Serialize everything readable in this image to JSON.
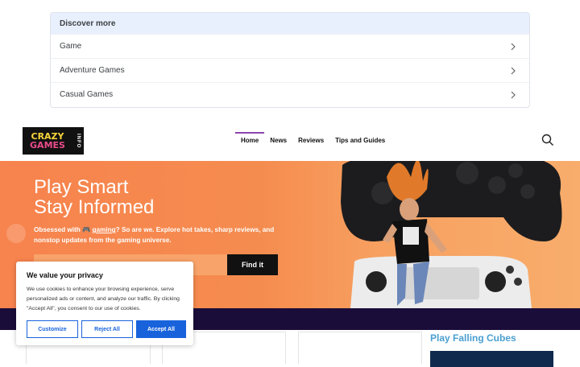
{
  "discover": {
    "title": "Discover more",
    "items": [
      {
        "label": "Game"
      },
      {
        "label": "Adventure Games"
      },
      {
        "label": "Casual Games"
      }
    ]
  },
  "header": {
    "logo": {
      "line1": "CRAZY",
      "line2": "GAMES",
      "side": "INFO"
    },
    "nav": [
      {
        "label": "Home",
        "active": true
      },
      {
        "label": "News"
      },
      {
        "label": "Reviews"
      },
      {
        "label": "Tips and Guides"
      }
    ]
  },
  "hero": {
    "title_line1": "Play Smart",
    "title_line2": "Stay Informed",
    "sub_pre": "Obsessed with ",
    "sub_link": "gaming",
    "sub_post": "? So are we. Explore hot takes, sharp reviews, and nonstop updates from the gaming universe.",
    "button": "Find it",
    "input_value": ""
  },
  "sidebar": {
    "play_title": "Play Falling Cubes"
  },
  "cookie": {
    "title": "We value your privacy",
    "text": "We use cookies to enhance your browsing experience, serve personalized ads or content, and analyze our traffic. By clicking \"Accept All\", you consent to our use of cookies.",
    "customize": "Customize",
    "reject": "Reject All",
    "accept": "Accept All"
  },
  "colors": {
    "accent": "#8e44ad",
    "hero": "#f7834e",
    "cookie_button": "#1863dc",
    "dark_strip": "#1a0d3a",
    "play_title": "#4a9fd1"
  }
}
